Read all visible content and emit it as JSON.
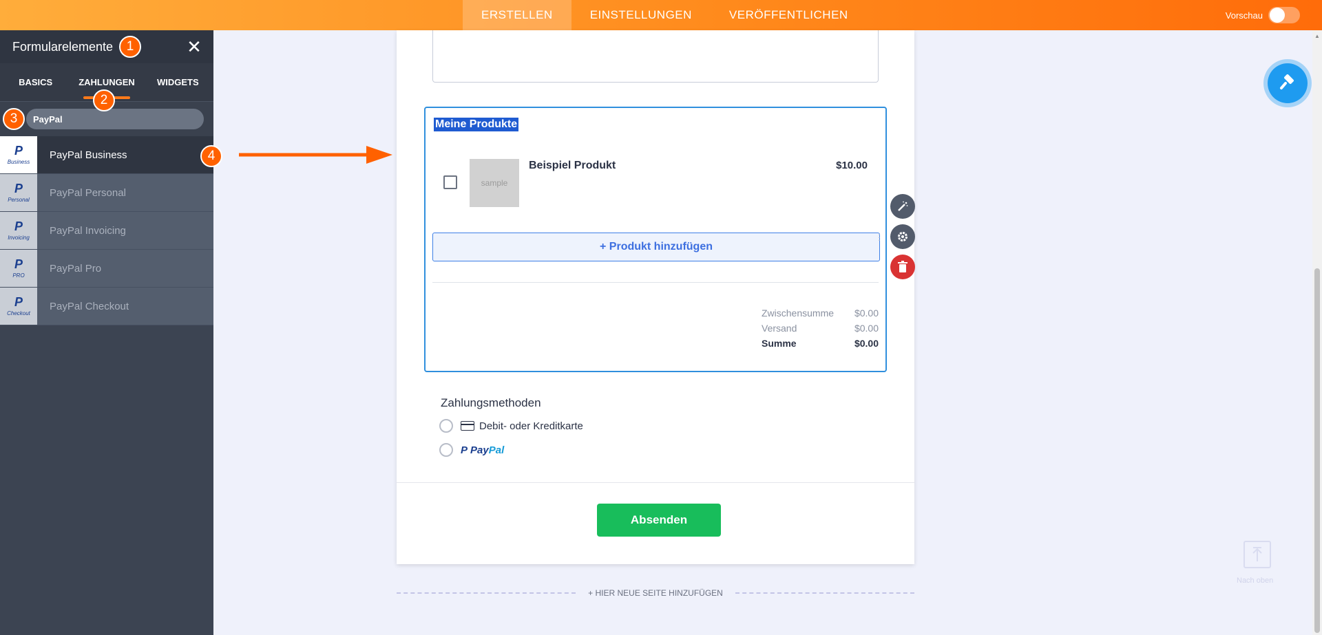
{
  "topbar": {
    "tabs": [
      "ERSTELLEN",
      "EINSTELLUNGEN",
      "VERÖFFENTLICHEN"
    ],
    "preview_label": "Vorschau"
  },
  "sidebar": {
    "title": "Formularelemente",
    "tabs": [
      "BASICS",
      "ZAHLUNGEN",
      "WIDGETS"
    ],
    "search_value": "PayPal",
    "items": [
      {
        "label": "PayPal Business",
        "thumb_sub": "Business"
      },
      {
        "label": "PayPal Personal",
        "thumb_sub": "Personal"
      },
      {
        "label": "PayPal Invoicing",
        "thumb_sub": "Invoicing"
      },
      {
        "label": "PayPal Pro",
        "thumb_sub": "PRO"
      },
      {
        "label": "PayPal Checkout",
        "thumb_sub": "Checkout"
      }
    ],
    "thumb_logo": "P"
  },
  "badges": [
    "1",
    "2",
    "3",
    "4"
  ],
  "product_block": {
    "title": "Meine Produkte",
    "product_name": "Beispiel Produkt",
    "product_price": "$10.00",
    "image_placeholder": "sample",
    "add_button": "+ Produkt hinzufügen",
    "totals": [
      {
        "label": "Zwischensumme",
        "value": "$0.00"
      },
      {
        "label": "Versand",
        "value": "$0.00"
      },
      {
        "label": "Summe",
        "value": "$0.00"
      }
    ]
  },
  "payment_methods": {
    "title": "Zahlungsmethoden",
    "option_card": "Debit- oder Kreditkarte",
    "paypal_logo": {
      "p": "P",
      "pay": "Pay",
      "pal": "Pal"
    }
  },
  "submit_label": "Absenden",
  "add_page_label": "+ HIER NEUE SEITE HINZUFÜGEN",
  "back_to_top_label": "Nach oben",
  "colors": {
    "accent": "#ff6c0a",
    "primary": "#2f8fdd",
    "success": "#18bd5b",
    "danger": "#d93333"
  }
}
